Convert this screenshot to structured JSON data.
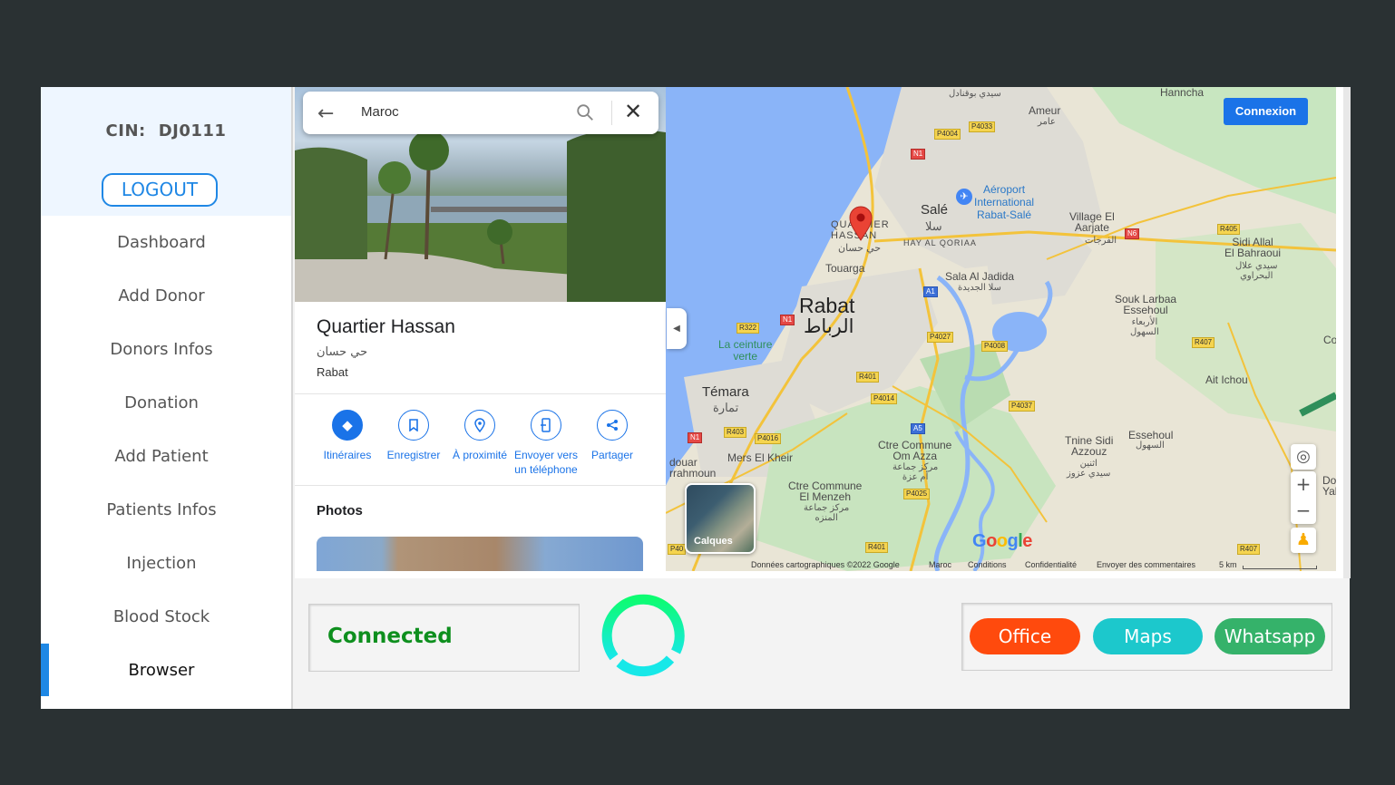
{
  "sidebar": {
    "cin_label": "CIN:",
    "cin_value": "DJ0111",
    "logout_label": "LOGOUT",
    "items": [
      {
        "label": "Dashboard"
      },
      {
        "label": "Add Donor"
      },
      {
        "label": "Donors Infos"
      },
      {
        "label": "Donation"
      },
      {
        "label": "Add Patient"
      },
      {
        "label": "Patients Infos"
      },
      {
        "label": "Injection"
      },
      {
        "label": "Blood Stock"
      },
      {
        "label": "Browser",
        "active": true
      }
    ],
    "accent_color": "#1e88e5"
  },
  "maps_panel": {
    "search_value": "Maroc",
    "place_title": "Quartier Hassan",
    "place_arabic": "حي حسان",
    "place_city": "Rabat",
    "actions": [
      {
        "label": "Itinéraires",
        "icon": "directions-icon"
      },
      {
        "label": "Enregistrer",
        "icon": "bookmark-icon"
      },
      {
        "label": "À proximité",
        "icon": "nearby-icon"
      },
      {
        "label": "Envoyer vers un téléphone",
        "icon": "send-to-phone-icon"
      },
      {
        "label": "Partager",
        "icon": "share-icon"
      }
    ],
    "photos_heading": "Photos"
  },
  "map": {
    "connexion_label": "Connexion",
    "layers_label": "Calques",
    "google_logo": "Google",
    "footer": {
      "data": "Données cartographiques ©2022 Google",
      "country": "Maroc",
      "conditions": "Conditions",
      "privacy": "Confidentialité",
      "feedback": "Envoyer des commentaires",
      "scale": "5 km"
    },
    "labels": {
      "rabat": "Rabat",
      "rabat_ar": "الرباط",
      "quartier": "QUARTIER\nHASSAN",
      "quartier_ar": "حي حسان",
      "sale": "Salé",
      "sale_ar": "سلا",
      "hay_al_qoriaa": "HAY AL QORIAA",
      "airport": "Aéroport\nInternational\nRabat-Salé",
      "touarga": "Touarga",
      "sala_al_jadida": "Sala Al Jadida",
      "sala_al_jadida_ar": "سلا الجديدة",
      "temara": "Témara",
      "temara_ar": "تمارة",
      "ceinture": "La ceinture\nverte",
      "mers_el_kheir": "Mers El Kheir",
      "om_azza": "Ctre Commune\nOm Azza",
      "om_azza_ar": "مركز جماعة\nأم عزة",
      "el_menzeh": "Ctre Commune\nEl Menzeh",
      "el_menzeh_ar": "مركز جماعة\nالمنزه",
      "ameur": "Ameur",
      "ameur_ar": "عامر",
      "hanncha": "Hanncha",
      "village": "Village El\nAarjate",
      "village_ar": "الفرجات",
      "sidi_allal": "Sidi Allal\nEl Bahraoui",
      "sidi_allal_ar": "سيدي علال\nالبحراوي",
      "souk": "Souk Larbaa\nEssehoul",
      "souk_ar": "الأربعاء\nالسهول",
      "ait_ichou": "Ait Ichou",
      "tnine": "Tnine Sidi\nAzzouz",
      "tnine_ar": "اثنين\nسيدي عزوز",
      "essehoul": "Essehoul",
      "essehoul_ar": "السهول",
      "douar": "douar\nrrahmoun",
      "sidi_top": "سيدي بوقنادل",
      "right_edge": "Co",
      "right_edge2": "Doua\nYak"
    },
    "roads": [
      "P4004",
      "P4033",
      "N1",
      "N6",
      "R405",
      "P4027",
      "R322",
      "N1",
      "P4008",
      "R401",
      "P4014",
      "A1",
      "A5",
      "R407",
      "P4037",
      "N1",
      "R403",
      "P4016",
      "P4025",
      "R401",
      "P40",
      "R407"
    ]
  },
  "status": {
    "connection_text": "Connected",
    "connection_color": "#0e8f1e"
  },
  "apps": [
    {
      "label": "Office",
      "color": "#ff4a0d"
    },
    {
      "label": "Maps",
      "color": "#1cc8cc"
    },
    {
      "label": "Whatsapp",
      "color": "#35b26a"
    }
  ]
}
